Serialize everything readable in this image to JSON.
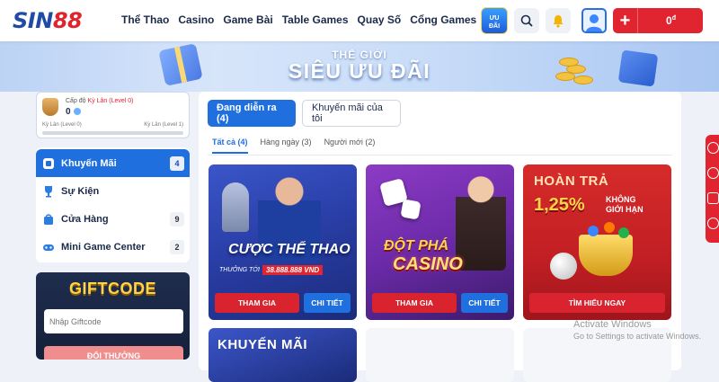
{
  "header": {
    "logo_sin": "SIN",
    "logo_num": "88",
    "nav": [
      "Thể Thao",
      "Casino",
      "Game Bài",
      "Table Games",
      "Quay Số",
      "Cổng Games"
    ],
    "uudai_label_1": "ƯU",
    "uudai_label_2": "ĐÃI",
    "balance": "0",
    "balance_unit": "đ",
    "plus": "+"
  },
  "hero": {
    "line1": "THẾ GIỚI",
    "line2": "SIÊU ƯU ĐÃI"
  },
  "profile": {
    "level_prefix": "Cấp độ",
    "level_name": "Kỳ Lân (Level 0)",
    "points": "0",
    "from_level": "Kỳ Lân (Level 0)",
    "to_level": "Kỳ Lân (Level 1)",
    "progress": 0
  },
  "menu": {
    "items": [
      {
        "label": "Khuyến Mãi",
        "count": "4",
        "icon": "promo-icon"
      },
      {
        "label": "Sự Kiện",
        "count": "",
        "icon": "trophy-icon"
      },
      {
        "label": "Cửa Hàng",
        "count": "9",
        "icon": "shopping-bag-icon"
      },
      {
        "label": "Mini Game Center",
        "count": "2",
        "icon": "gamepad-icon"
      }
    ]
  },
  "giftcode": {
    "title": "GIFTCODE",
    "placeholder": "Nhập Giftcode",
    "button": "ĐỔI THƯỞNG"
  },
  "main": {
    "tabs": [
      "Đang diễn ra (4)",
      "Khuyến mãi của tôi"
    ],
    "subtabs": [
      "Tất cả (4)",
      "Hàng ngày (3)",
      "Người mới (2)"
    ],
    "cards": [
      {
        "title": "CƯỢC THỂ THAO",
        "sub": "THƯỞNG TỚI",
        "value": "38.888.888 VND",
        "btn1": "THAM GIA",
        "btn2": "CHI TIẾT"
      },
      {
        "title1": "ĐỘT PHÁ",
        "title2": "CASINO",
        "btn1": "THAM GIA",
        "btn2": "CHI TIẾT"
      },
      {
        "title1": "HOÀN TRẢ",
        "title2": "1,25%",
        "title3a": "KHÔNG",
        "title3b": "GIỚI HẠN",
        "btn1": "TÌM HIỂU NGAY"
      }
    ],
    "card4_title": "KHUYẾN MÃI"
  },
  "watermark": {
    "line1": "Activate Windows",
    "line2": "Go to Settings to activate Windows."
  },
  "colors": {
    "brand_blue": "#1f6fde",
    "brand_red": "#e02430"
  }
}
